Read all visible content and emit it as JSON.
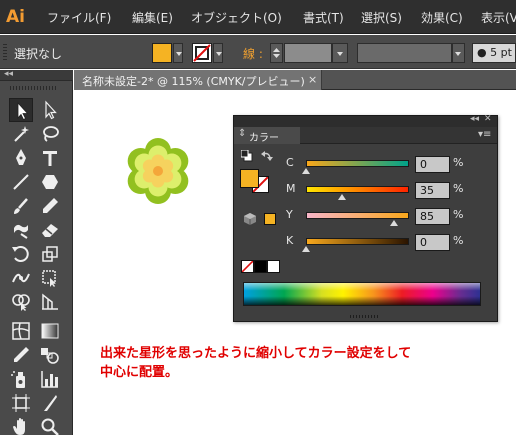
{
  "app": {
    "logo": "Ai"
  },
  "menu": [
    "ファイル(F)",
    "編集(E)",
    "オブジェクト(O)",
    "書式(T)",
    "選択(S)",
    "効果(C)",
    "表示(V)"
  ],
  "control_bar": {
    "selection_label": "選択なし",
    "fill_color": "#f5b323",
    "stroke_label": "線 :",
    "brush_size": "5 pt"
  },
  "document": {
    "tab_title": "名称未設定-2* @ 115% (CMYK/プレビュー)",
    "close": "×"
  },
  "tools": [
    "selection-tool",
    "direct-selection-tool",
    "magic-wand-tool",
    "lasso-tool",
    "pen-tool",
    "type-tool",
    "line-tool",
    "polygon-tool",
    "paintbrush-tool",
    "pencil-tool",
    "blob-brush-tool",
    "eraser-tool",
    "rotate-tool",
    "scale-tool",
    "width-tool",
    "free-transform-tool",
    "shape-builder-tool",
    "perspective-grid-tool",
    "mesh-tool",
    "gradient-tool",
    "eyedropper-tool",
    "blend-tool",
    "symbol-sprayer-tool",
    "column-graph-tool",
    "artboard-tool",
    "slice-tool",
    "hand-tool",
    "zoom-tool"
  ],
  "color_panel": {
    "tab_label": "カラー",
    "fill_color": "#f5b323",
    "channels": [
      {
        "label": "C",
        "value": "0",
        "unit": "%",
        "fraction": 0.0
      },
      {
        "label": "M",
        "value": "35",
        "unit": "%",
        "fraction": 0.35
      },
      {
        "label": "Y",
        "value": "85",
        "unit": "%",
        "fraction": 0.85
      },
      {
        "label": "K",
        "value": "0",
        "unit": "%",
        "fraction": 0.0
      }
    ]
  },
  "canvas": {
    "instruction_line1": "出来た星形を思ったように縮小してカラー設定をして",
    "instruction_line2": "中心に配置。",
    "flower_colors": {
      "outer": "#92c020",
      "middle": "#ddef6c",
      "inner": "#f6d25e",
      "center": "#f4a63a"
    }
  }
}
